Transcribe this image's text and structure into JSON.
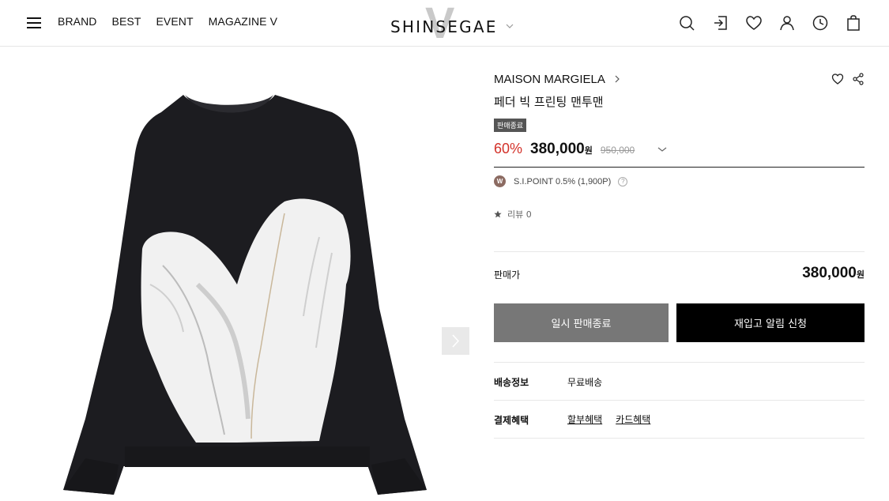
{
  "header": {
    "nav": [
      "BRAND",
      "BEST",
      "EVENT",
      "MAGAZINE V"
    ],
    "logo_text": "SHINSEGAE",
    "logo_mark": "V",
    "icons": [
      "search-icon",
      "login-icon",
      "heart-icon",
      "user-icon",
      "clock-icon",
      "shopping-bag-icon"
    ]
  },
  "product": {
    "brand": "MAISON MARGIELA",
    "name": "페더 빅 프린팅 맨투맨",
    "badge": "판매종료",
    "discount": "60%",
    "sale_price": "380,000",
    "currency": "원",
    "original_price": "950,000",
    "point_badge": "W",
    "point_text": "S.I.POINT 0.5% (1,900P)",
    "help_mark": "?",
    "review_text": "리뷰 0",
    "sell_price_label": "판매가",
    "sell_price": "380,000",
    "sell_currency": "원"
  },
  "buttons": {
    "soldout": "일시 판매종료",
    "restock": "재입고 알림 신청"
  },
  "delivery": {
    "label": "배송정보",
    "value": "무료배송"
  },
  "benefits": {
    "label": "결제혜택",
    "links": [
      "할부혜택",
      "카드혜택"
    ]
  },
  "colors": {
    "discount": "#d3322a",
    "soldout_button": "#777777",
    "restock_button": "#000000",
    "point_badge": "#8c6b62"
  }
}
